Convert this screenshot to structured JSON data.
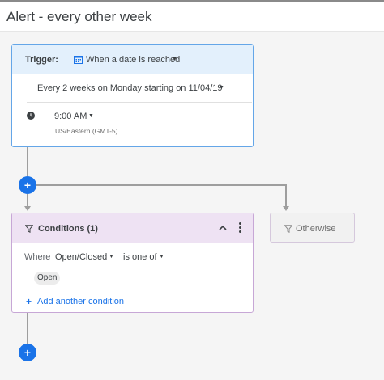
{
  "header": {
    "title": "Alert - every other week"
  },
  "trigger": {
    "label": "Trigger:",
    "type": "When a date is reached",
    "schedule": "Every 2 weeks on Monday starting on 11/04/19",
    "time": "9:00 AM",
    "timezone": "US/Eastern (GMT-5)",
    "dropdown_caret": "▼",
    "icons": {
      "type": "calendar-icon",
      "time": "clock-icon"
    }
  },
  "conditions": {
    "title": "Conditions (1)",
    "where_label": "Where",
    "field": "Open/Closed",
    "operator": "is one of",
    "chip": "Open",
    "add_link": "Add another condition",
    "add_plus": "+",
    "icons": {
      "title": "filter-icon",
      "collapse": "chevron-up-icon",
      "menu": "more-vert-icon"
    }
  },
  "otherwise": {
    "label": "Otherwise",
    "icon": "filter-icon"
  },
  "add_step": {
    "label": "+"
  },
  "colors": {
    "accent": "#1a73e8",
    "trigger_header": "#e3f0fc",
    "trigger_border": "#64a6e8",
    "conditions_header": "#eee2f3",
    "conditions_border": "#c7a7d6"
  }
}
